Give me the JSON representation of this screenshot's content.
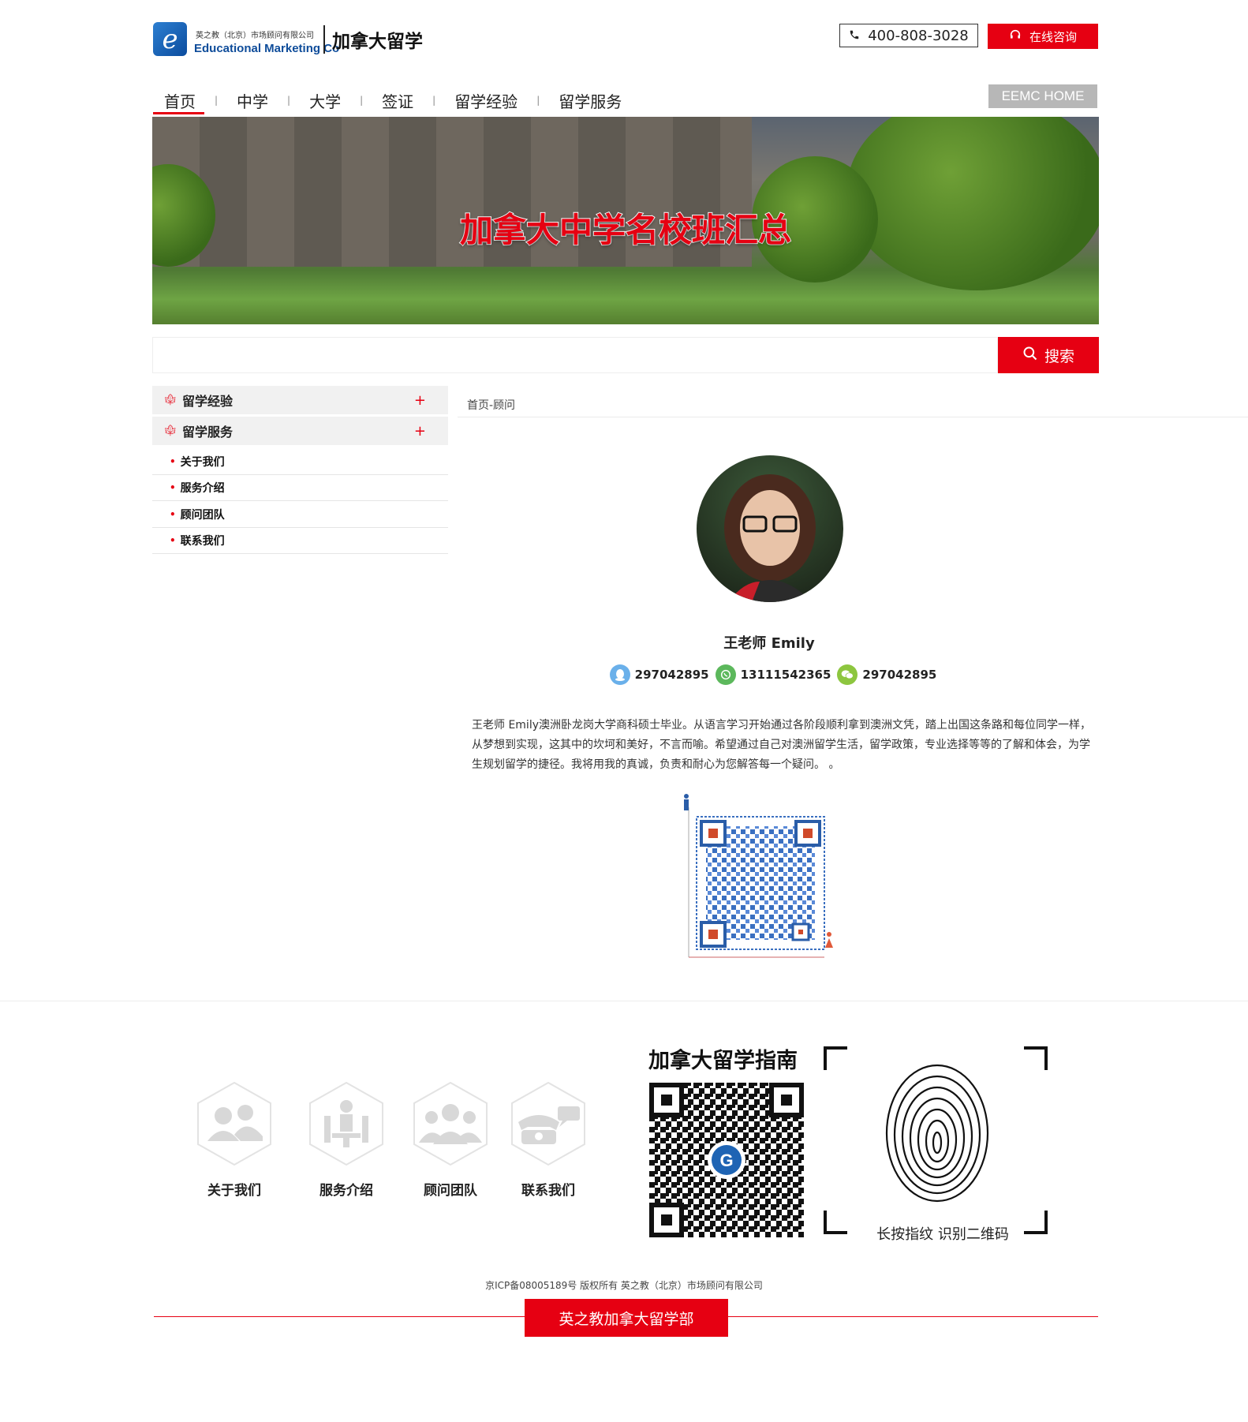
{
  "header": {
    "logo_cn": "英之教（北京）市场顾问有限公司",
    "logo_en": "Educational Marketing Co",
    "site_title": "加拿大留学",
    "phone": "400-808-3028",
    "consult_label": "在线咨询",
    "home_label": "EEMC HOME"
  },
  "nav": {
    "items": [
      "首页",
      "中学",
      "大学",
      "签证",
      "留学经验",
      "留学服务"
    ],
    "active": "首页"
  },
  "banner": {
    "title": "加拿大中学名校班汇总"
  },
  "search": {
    "placeholder": "",
    "button_label": "搜索"
  },
  "sidebar": {
    "sections": [
      "留学经验",
      "留学服务"
    ],
    "sub_items": [
      "关于我们",
      "服务介绍",
      "顾问团队",
      "联系我们"
    ]
  },
  "breadcrumb": "首页-顾问",
  "profile": {
    "name": "王老师 Emily",
    "qq": "297042895",
    "whatsapp": "13111542365",
    "wechat": "297042895",
    "bio": "王老师 Emily澳洲卧龙岗大学商科硕士毕业。从语言学习开始通过各阶段顺利拿到澳洲文凭，踏上出国这条路和每位同学一样，从梦想到实现，这其中的坎坷和美好，不言而喻。希望通过自己对澳洲留学生活，留学政策，专业选择等等的了解和体会，为学生规划留学的捷径。我将用我的真诚，负责和耐心为您解答每一个疑问。 。"
  },
  "footer": {
    "links": [
      "关于我们",
      "服务介绍",
      "顾问团队",
      "联系我们"
    ],
    "guide_title": "加拿大留学指南",
    "fingerprint_label": "长按指纹 识别二维码",
    "copyright": "京ICP备08005189号 版权所有 英之教（北京）市场顾问有限公司",
    "bottom_button": "英之教加拿大留学部"
  },
  "colors": {
    "accent": "#e60012",
    "grey_button": "#b7b7b7",
    "sidebar_bg": "#f1f1f1"
  },
  "icons": [
    "phone-icon",
    "headset-icon",
    "search-icon",
    "maple-leaf-icon",
    "plus-icon",
    "qq-icon",
    "whatsapp-icon",
    "wechat-icon",
    "fingerprint-icon"
  ]
}
